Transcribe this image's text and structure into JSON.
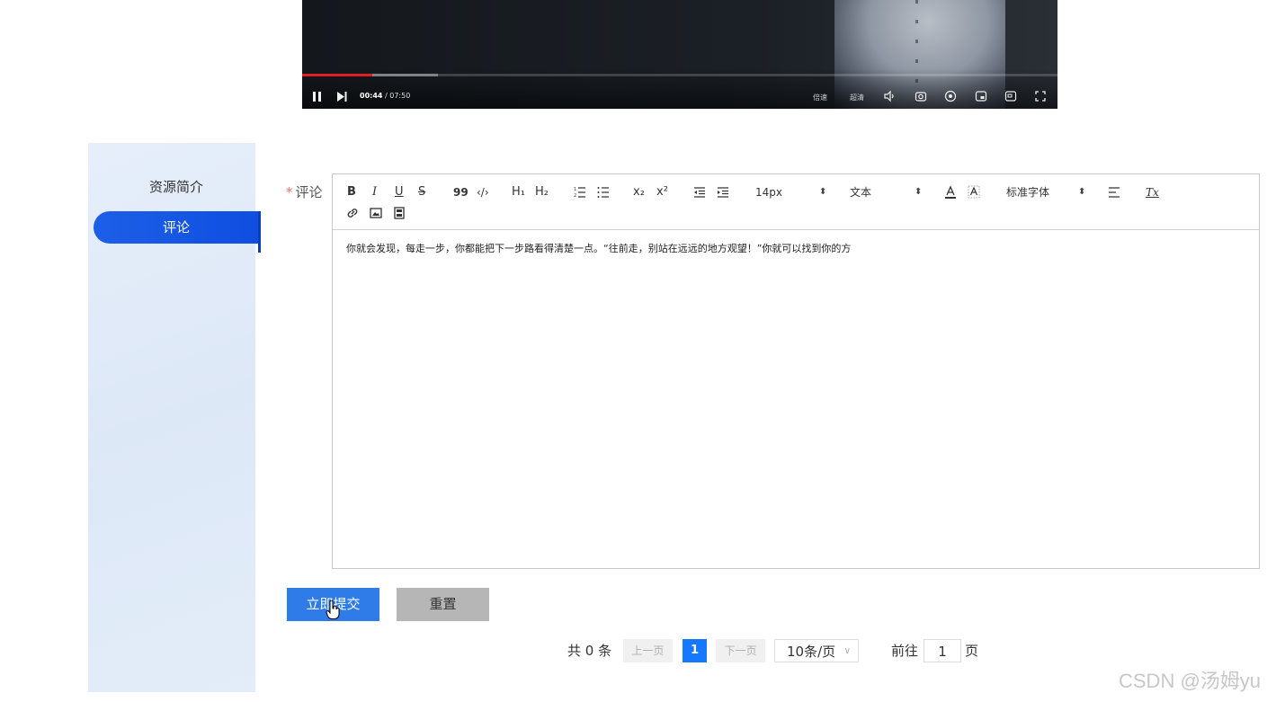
{
  "video": {
    "played_fraction": 0.093,
    "buffered_fraction": 0.18,
    "current_time": "00:44",
    "duration": "/ 07:50",
    "speed_label": "倍速",
    "quality_label": "超清"
  },
  "sidebar": {
    "items": [
      {
        "label": "资源简介",
        "active": false
      },
      {
        "label": "评论",
        "active": true
      }
    ]
  },
  "form": {
    "required_mark": "*",
    "comment_label": "评论"
  },
  "editor": {
    "toolbar": {
      "bold": "B",
      "italic": "I",
      "underline": "U",
      "strike": "S",
      "blockquote": "99",
      "code": "‹/›",
      "h1": "H₁",
      "h2": "H₂",
      "subscript": "x₂",
      "superscript": "x²",
      "font_size": "14px",
      "header": "文本",
      "font_family": "标准字体",
      "clean": "Tx"
    },
    "content": "你就会发现，每走一步，你都能把下一步路看得清楚一点。“往前走，别站在远远的地方观望！”你就可以找到你的方"
  },
  "buttons": {
    "submit": "立即提交",
    "reset": "重置"
  },
  "pagination": {
    "total": "共 0 条",
    "prev": "上一页",
    "current": "1",
    "next": "下一页",
    "page_size": "10条/页",
    "goto_prefix": "前往",
    "goto_value": "1",
    "goto_suffix": "页"
  },
  "watermark": "CSDN @汤姆yu",
  "colors": {
    "primary": "#2f7be8",
    "active_nav": "#1d5fe8",
    "required": "#f56c6c",
    "progress": "#e02020"
  }
}
